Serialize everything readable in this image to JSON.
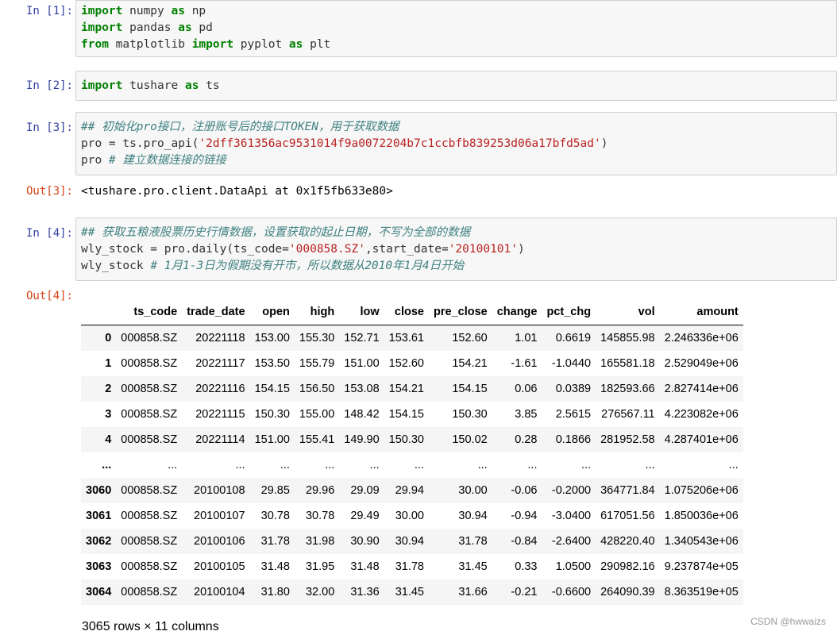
{
  "cells": [
    {
      "prompt": "In  [1]:",
      "lines": [
        [
          {
            "t": "import",
            "c": "kw"
          },
          {
            "t": " numpy "
          },
          {
            "t": "as",
            "c": "kw"
          },
          {
            "t": " np"
          }
        ],
        [
          {
            "t": "import",
            "c": "kw"
          },
          {
            "t": " pandas "
          },
          {
            "t": "as",
            "c": "kw"
          },
          {
            "t": " pd"
          }
        ],
        [
          {
            "t": "from",
            "c": "kw"
          },
          {
            "t": " matplotlib "
          },
          {
            "t": "import",
            "c": "kw"
          },
          {
            "t": " pyplot "
          },
          {
            "t": "as",
            "c": "kw"
          },
          {
            "t": " plt"
          }
        ]
      ]
    },
    {
      "prompt": "In  [2]:",
      "lines": [
        [
          {
            "t": "import",
            "c": "kw"
          },
          {
            "t": " tushare "
          },
          {
            "t": "as",
            "c": "kw"
          },
          {
            "t": " ts"
          }
        ]
      ]
    },
    {
      "prompt": "In  [3]:",
      "lines": [
        [
          {
            "t": "## 初始化pro接口，注册账号后的接口TOKEN，用于获取数据",
            "c": "cm"
          }
        ],
        [
          {
            "t": "pro = ts.pro_api("
          },
          {
            "t": "'2dff361356ac9531014f9a0072204b7c1ccbfb839253d06a17bfd5ad'",
            "c": "st"
          },
          {
            "t": ")"
          }
        ],
        [
          {
            "t": "pro "
          },
          {
            "t": "# 建立数据连接的链接",
            "c": "cm"
          }
        ]
      ],
      "out_prompt": "Out[3]:",
      "out_text": "<tushare.pro.client.DataApi at 0x1f5fb633e80>"
    },
    {
      "prompt": "In  [4]:",
      "lines": [
        [
          {
            "t": "## 获取五粮液股票历史行情数据，设置获取的起止日期，不写为全部的数据",
            "c": "cm"
          }
        ],
        [
          {
            "t": "wly_stock = pro.daily(ts_code="
          },
          {
            "t": "'000858.SZ'",
            "c": "st"
          },
          {
            "t": ",start_date="
          },
          {
            "t": "'20100101'",
            "c": "st"
          },
          {
            "t": ")"
          }
        ],
        [
          {
            "t": "wly_stock "
          },
          {
            "t": "# 1月1-3日为假期没有开市，所以数据从2010年1月4日开始",
            "c": "cm"
          }
        ]
      ],
      "out_prompt": "Out[4]:"
    }
  ],
  "table": {
    "columns": [
      "",
      "ts_code",
      "trade_date",
      "open",
      "high",
      "low",
      "close",
      "pre_close",
      "change",
      "pct_chg",
      "vol",
      "amount"
    ],
    "rows": [
      [
        "0",
        "000858.SZ",
        "20221118",
        "153.00",
        "155.30",
        "152.71",
        "153.61",
        "152.60",
        "1.01",
        "0.6619",
        "145855.98",
        "2.246336e+06"
      ],
      [
        "1",
        "000858.SZ",
        "20221117",
        "153.50",
        "155.79",
        "151.00",
        "152.60",
        "154.21",
        "-1.61",
        "-1.0440",
        "165581.18",
        "2.529049e+06"
      ],
      [
        "2",
        "000858.SZ",
        "20221116",
        "154.15",
        "156.50",
        "153.08",
        "154.21",
        "154.15",
        "0.06",
        "0.0389",
        "182593.66",
        "2.827414e+06"
      ],
      [
        "3",
        "000858.SZ",
        "20221115",
        "150.30",
        "155.00",
        "148.42",
        "154.15",
        "150.30",
        "3.85",
        "2.5615",
        "276567.11",
        "4.223082e+06"
      ],
      [
        "4",
        "000858.SZ",
        "20221114",
        "151.00",
        "155.41",
        "149.90",
        "150.30",
        "150.02",
        "0.28",
        "0.1866",
        "281952.58",
        "4.287401e+06"
      ],
      [
        "...",
        "...",
        "...",
        "...",
        "...",
        "...",
        "...",
        "...",
        "...",
        "...",
        "...",
        "..."
      ],
      [
        "3060",
        "000858.SZ",
        "20100108",
        "29.85",
        "29.96",
        "29.09",
        "29.94",
        "30.00",
        "-0.06",
        "-0.2000",
        "364771.84",
        "1.075206e+06"
      ],
      [
        "3061",
        "000858.SZ",
        "20100107",
        "30.78",
        "30.78",
        "29.49",
        "30.00",
        "30.94",
        "-0.94",
        "-3.0400",
        "617051.56",
        "1.850036e+06"
      ],
      [
        "3062",
        "000858.SZ",
        "20100106",
        "31.78",
        "31.98",
        "30.90",
        "30.94",
        "31.78",
        "-0.84",
        "-2.6400",
        "428220.40",
        "1.340543e+06"
      ],
      [
        "3063",
        "000858.SZ",
        "20100105",
        "31.48",
        "31.95",
        "31.48",
        "31.78",
        "31.45",
        "0.33",
        "1.0500",
        "290982.16",
        "9.237874e+05"
      ],
      [
        "3064",
        "000858.SZ",
        "20100104",
        "31.80",
        "32.00",
        "31.36",
        "31.45",
        "31.66",
        "-0.21",
        "-0.6600",
        "264090.39",
        "8.363519e+05"
      ]
    ],
    "summary": "3065 rows × 11 columns"
  },
  "watermark": "CSDN @hwwaizs",
  "colors": {
    "keyword": "#008000",
    "comment": "#408080",
    "string": "#ba2121",
    "in_prompt": "#303f9f",
    "out_prompt": "#d84315"
  }
}
